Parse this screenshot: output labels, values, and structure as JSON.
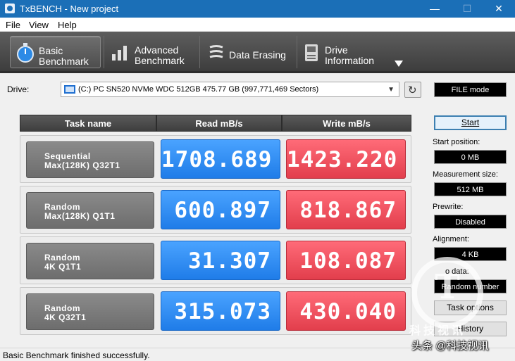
{
  "window": {
    "title": "TxBENCH - New project",
    "minimize": "—",
    "maximize": "☐",
    "close": "✕"
  },
  "menu": [
    "File",
    "View",
    "Help"
  ],
  "toolbar": {
    "tabs": [
      {
        "line1": "Basic",
        "line2": "Benchmark",
        "icon": "stopwatch-icon",
        "active": true
      },
      {
        "line1": "Advanced",
        "line2": "Benchmark",
        "icon": "bar-chart-icon",
        "active": false
      },
      {
        "line1": "Data Erasing",
        "line2": "",
        "icon": "eraser-icon",
        "active": false
      },
      {
        "line1": "Drive",
        "line2": "Information",
        "icon": "drive-info-icon",
        "active": false
      }
    ],
    "more_icon": "chevron-down-icon"
  },
  "drive": {
    "label": "Drive:",
    "selected": "(C:) PC SN520 NVMe WDC 512GB  475.77 GB (997,771,469 Sectors)",
    "refresh_icon": "refresh-icon",
    "mode": "FILE mode"
  },
  "table": {
    "headers": [
      "Task name",
      "Read mB/s",
      "Write mB/s"
    ],
    "rows": [
      {
        "task_line1": "Sequential",
        "task_line2": "Max(128K) Q32T1",
        "read": "1708.689",
        "write": "1423.220"
      },
      {
        "task_line1": "Random",
        "task_line2": "Max(128K) Q1T1",
        "read": "600.897",
        "write": "818.867"
      },
      {
        "task_line1": "Random",
        "task_line2": "4K Q1T1",
        "read": "31.307",
        "write": "108.087"
      },
      {
        "task_line1": "Random",
        "task_line2": "4K Q32T1",
        "read": "315.073",
        "write": "430.040"
      }
    ]
  },
  "settings": {
    "start_button": "Start",
    "start_position_label": "Start position:",
    "start_position_value": "0 MB",
    "measurement_size_label": "Measurement size:",
    "measurement_size_value": "512 MB",
    "prewrite_label": "Prewrite:",
    "prewrite_value": "Disabled",
    "alignment_label": "Alignment:",
    "alignment_value": "4 KB",
    "data_label": "o data:",
    "data_value": "Random number",
    "task_options_button": "Task options",
    "history_button": "History"
  },
  "status": {
    "text": "Basic Benchmark finished successfully."
  },
  "watermark": {
    "letter": "T",
    "small_text": "科技视讯",
    "credit": "头条 @科技视讯"
  },
  "colors": {
    "titlebar": "#1b6fb7",
    "read": "#2f8cf4",
    "write": "#f2515f",
    "toolbar": "#4a4a4a"
  }
}
